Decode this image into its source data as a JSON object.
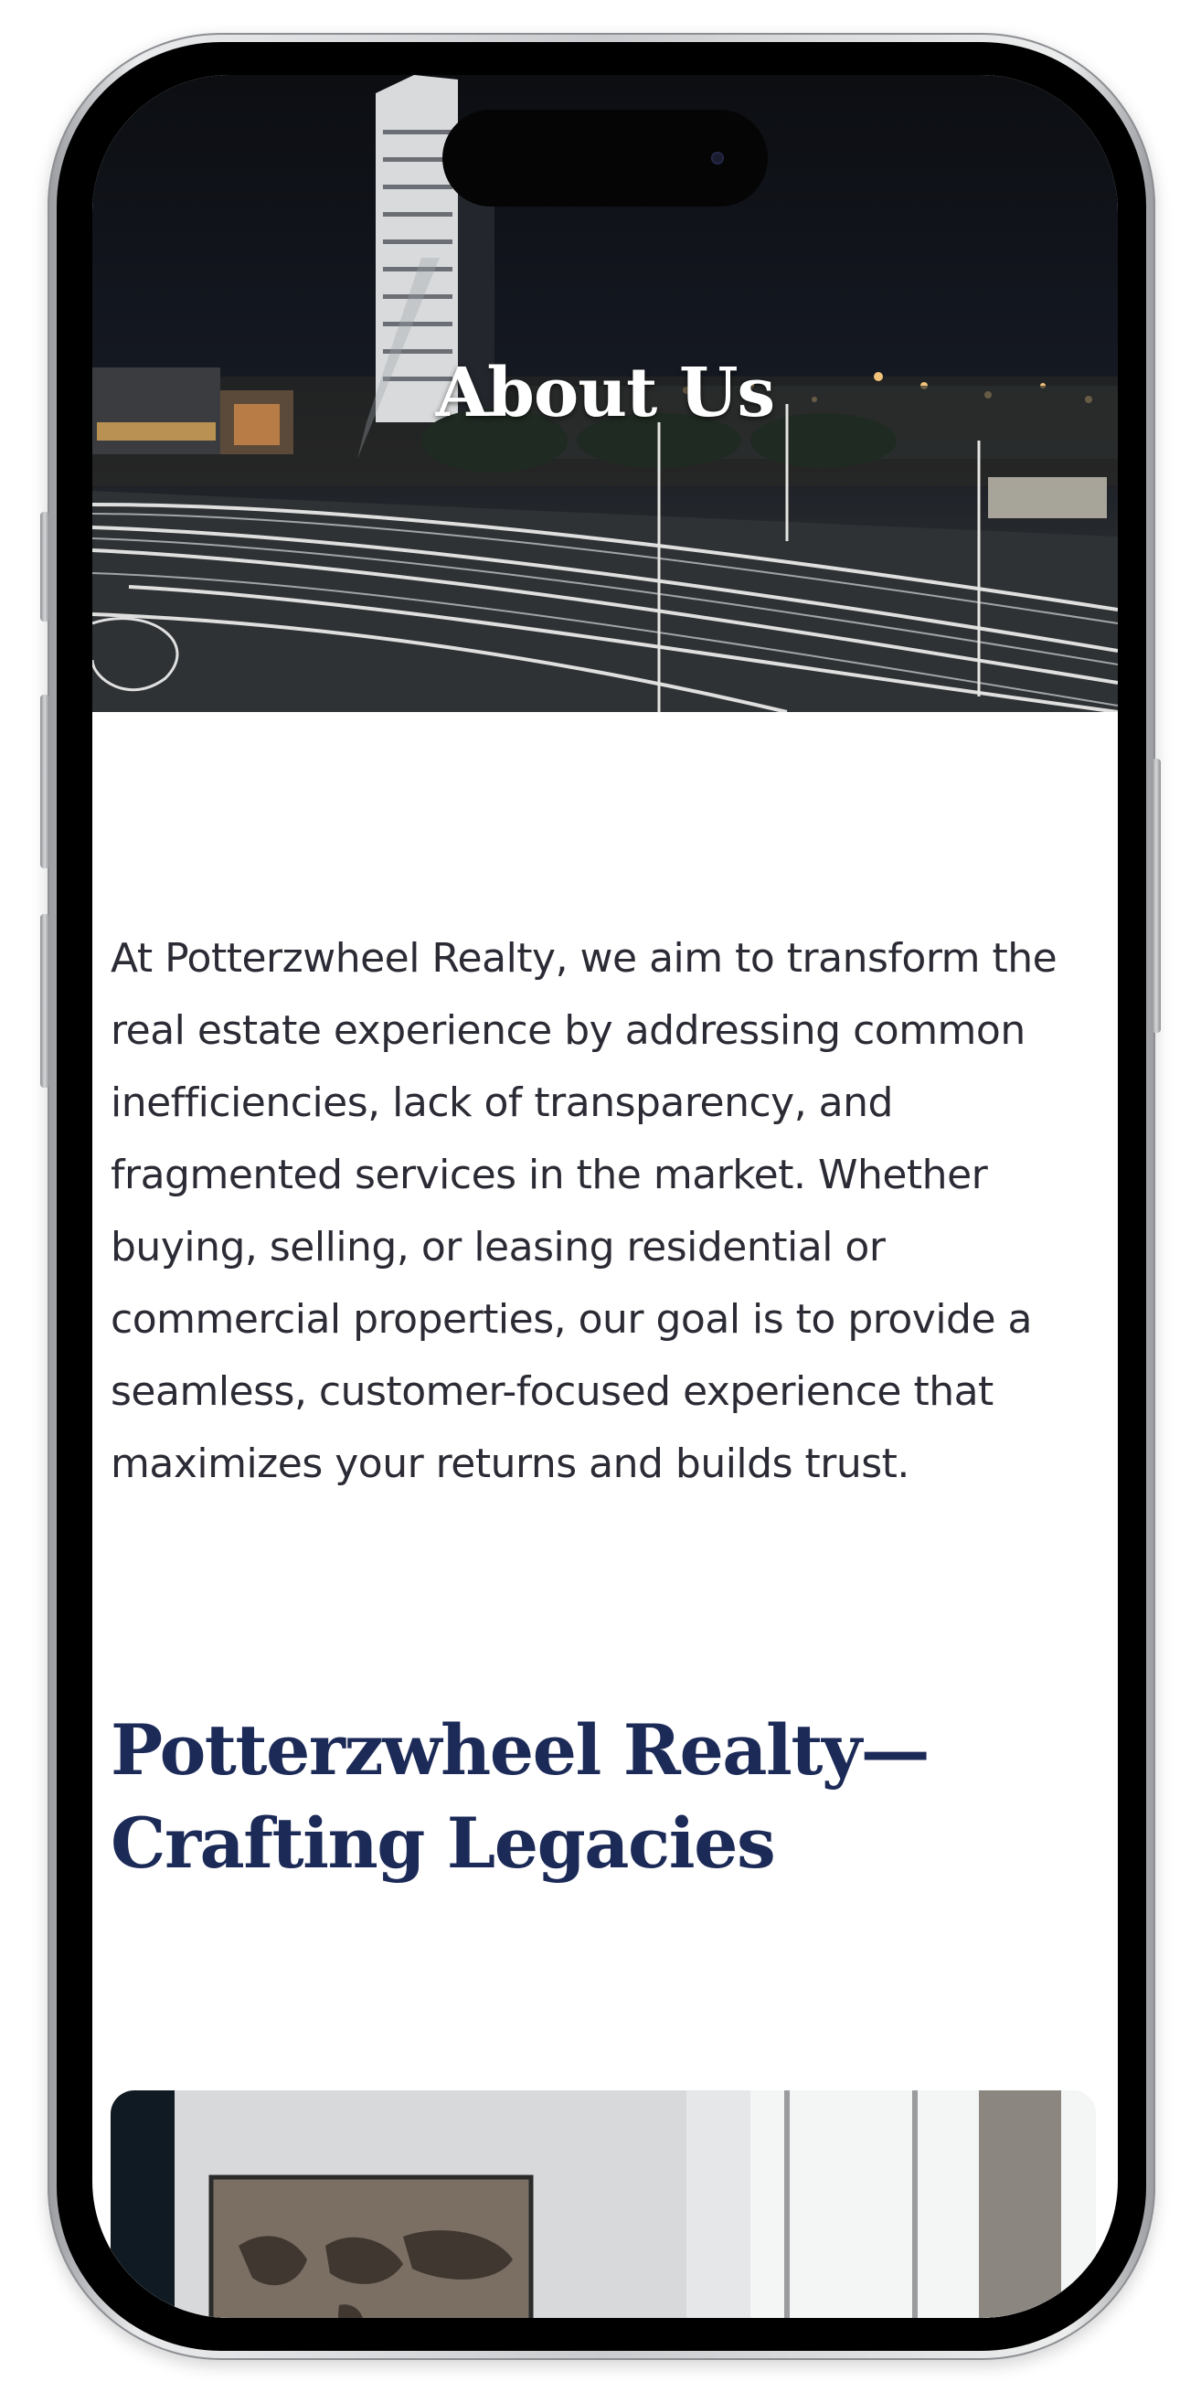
{
  "hero": {
    "title": "About Us",
    "image_icon": "city-night-highway-photo"
  },
  "intro": {
    "paragraph": "At Potterzwheel Realty, we aim to transform the real estate experience by addressing common inefficiencies, lack of transparency, and fragmented services in the market. Whether buying, selling, or leasing residential or commercial properties, our goal is to provide a seamless, customer-focused experience that maximizes your returns and builds trust."
  },
  "section": {
    "heading": "Potterzwheel Realty—Crafting Legacies"
  },
  "team_image": {
    "image_icon": "office-team-meeting-photo"
  },
  "colors": {
    "heading": "#1c2a57",
    "body_text": "#2b2b35",
    "hero_dark": "#0c0e12"
  }
}
